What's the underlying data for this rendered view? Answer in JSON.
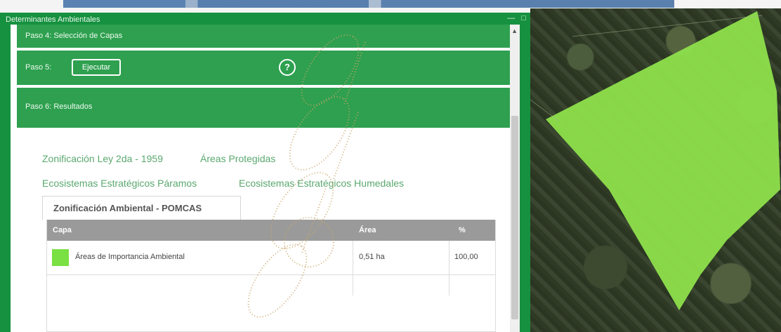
{
  "widget": {
    "title": "Determinantes Ambientales",
    "controls": [
      "—",
      "□"
    ]
  },
  "steps": {
    "step4": "Paso 4: Selección de Capas",
    "step5_label": "Paso 5:",
    "execute_label": "Ejecutar",
    "help_glyph": "?",
    "step6": "Paso 6: Resultados"
  },
  "tabs": {
    "row1": [
      "Zonificación Ley 2da - 1959",
      "Áreas Protegidas"
    ],
    "row2": [
      "Ecosistemas Estratégicos Páramos",
      "Ecosistemas Estratégicos Humedales"
    ],
    "active": "Zonificación Ambiental - POMCAS"
  },
  "table": {
    "headers": [
      "Capa",
      "Área",
      "%"
    ],
    "rows": [
      {
        "capa": "Áreas de Importancia Ambiental",
        "area": "0,51 ha",
        "pct": "100,00",
        "swatch_color": "#7ae043"
      }
    ]
  },
  "colors": {
    "panel": "#16913f",
    "step": "#2ea04f",
    "polygon": "#8ee04c"
  }
}
